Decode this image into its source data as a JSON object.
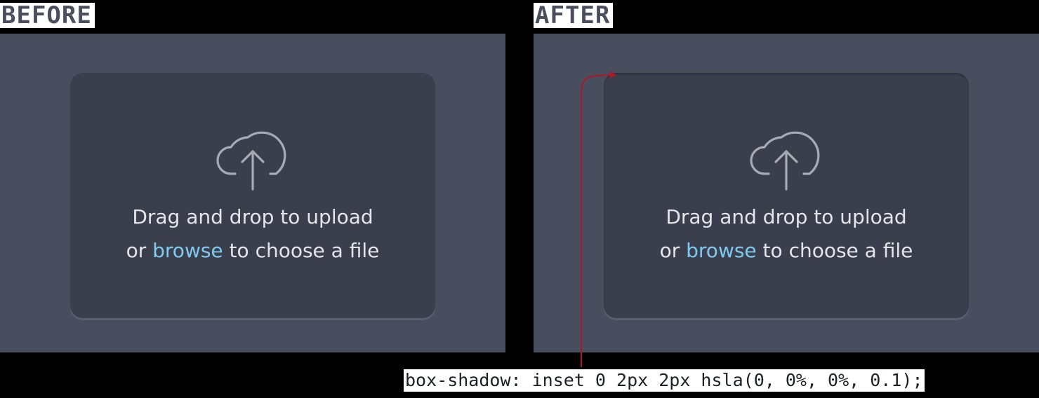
{
  "labels": {
    "before": "BEFORE",
    "after": "AFTER"
  },
  "dropzone": {
    "line1": "Drag and drop to upload",
    "line2_prefix": "or ",
    "browse_link": "browse",
    "line2_suffix": " to choose a file",
    "icon": "cloud-upload-icon"
  },
  "annotation": {
    "code": "box-shadow: inset 0 2px 2px hsla(0, 0%, 0%, 0.1);"
  },
  "colors": {
    "panel": "#484e5e",
    "dropzone": "#3b3f4d",
    "link": "#7ecbef",
    "arrow": "#b0162a"
  }
}
